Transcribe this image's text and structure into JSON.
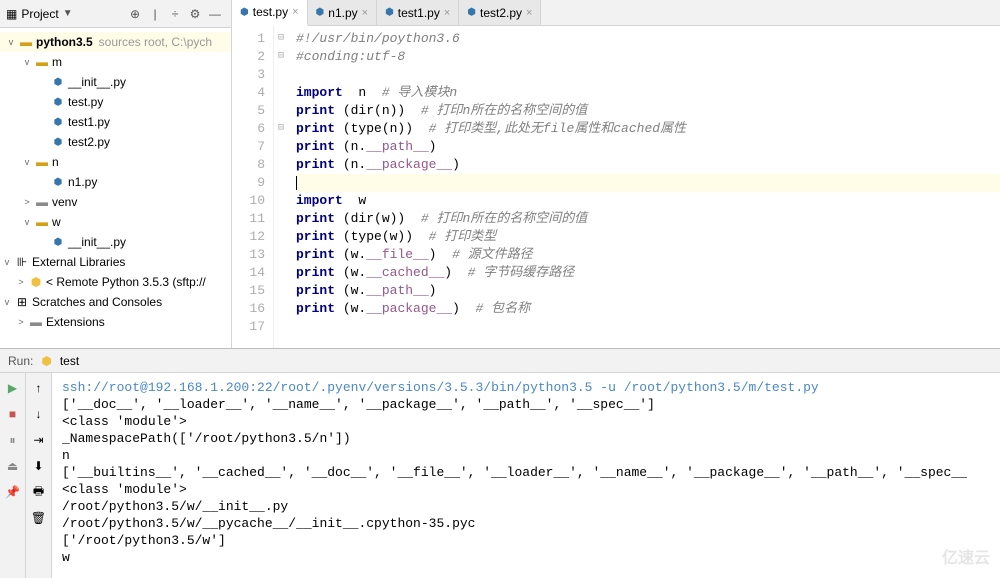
{
  "sidebar": {
    "title": "Project",
    "root": {
      "label": "python3.5",
      "hint": "sources root, C:\\pych"
    },
    "tree": [
      {
        "depth": 1,
        "chev": "v",
        "icon": "folder",
        "iconClass": "folder-yellow",
        "label": "m",
        "bold": false
      },
      {
        "depth": 2,
        "chev": "",
        "icon": "py",
        "label": "__init__.py"
      },
      {
        "depth": 2,
        "chev": "",
        "icon": "py",
        "label": "test.py"
      },
      {
        "depth": 2,
        "chev": "",
        "icon": "py",
        "label": "test1.py"
      },
      {
        "depth": 2,
        "chev": "",
        "icon": "py",
        "label": "test2.py"
      },
      {
        "depth": 1,
        "chev": "v",
        "icon": "folder",
        "iconClass": "folder-yellow",
        "label": "n"
      },
      {
        "depth": 2,
        "chev": "",
        "icon": "py",
        "label": "n1.py"
      },
      {
        "depth": 1,
        "chev": ">",
        "icon": "folder",
        "iconClass": "folder-gray",
        "label": "venv"
      },
      {
        "depth": 1,
        "chev": "v",
        "icon": "folder",
        "iconClass": "folder-yellow",
        "label": "w"
      },
      {
        "depth": 2,
        "chev": "",
        "icon": "py",
        "label": "__init__.py"
      }
    ],
    "ext_lib": "External Libraries",
    "remote": "< Remote Python 3.5.3 (sftp://",
    "scratches": "Scratches and Consoles",
    "extensions": "Extensions"
  },
  "tabs": [
    {
      "label": "test.py",
      "active": true
    },
    {
      "label": "n1.py",
      "active": false
    },
    {
      "label": "test1.py",
      "active": false
    },
    {
      "label": "test2.py",
      "active": false
    }
  ],
  "code": {
    "lines": [
      {
        "n": 1,
        "fold": "⊟",
        "seg": [
          {
            "c": "cm",
            "t": "#!/usr/bin/poython3.6"
          }
        ]
      },
      {
        "n": 2,
        "fold": "⊟",
        "seg": [
          {
            "c": "cm",
            "t": "#conding:utf-8"
          }
        ]
      },
      {
        "n": 3,
        "fold": "",
        "seg": []
      },
      {
        "n": 4,
        "fold": "",
        "seg": [
          {
            "c": "kw",
            "t": "import"
          },
          {
            "c": "",
            "t": "  n  "
          },
          {
            "c": "cm",
            "t": "# 导入模块n"
          }
        ]
      },
      {
        "n": 5,
        "fold": "",
        "seg": [
          {
            "c": "kw",
            "t": "print"
          },
          {
            "c": "",
            "t": " (dir(n))  "
          },
          {
            "c": "cm",
            "t": "# 打印n所在的名称空间的值"
          }
        ]
      },
      {
        "n": 6,
        "fold": "⊟",
        "seg": [
          {
            "c": "kw",
            "t": "print"
          },
          {
            "c": "",
            "t": " (type(n))  "
          },
          {
            "c": "cm",
            "t": "# 打印类型,此处无file属性和cached属性"
          }
        ]
      },
      {
        "n": 7,
        "fold": "",
        "seg": [
          {
            "c": "kw",
            "t": "print"
          },
          {
            "c": "",
            "t": " (n."
          },
          {
            "c": "mag",
            "t": "__path__"
          },
          {
            "c": "",
            "t": ")"
          }
        ]
      },
      {
        "n": 8,
        "fold": "",
        "seg": [
          {
            "c": "kw",
            "t": "print"
          },
          {
            "c": "",
            "t": " (n."
          },
          {
            "c": "mag",
            "t": "__package__"
          },
          {
            "c": "",
            "t": ")"
          }
        ]
      },
      {
        "n": 9,
        "fold": "",
        "hl": true,
        "seg": []
      },
      {
        "n": 10,
        "fold": "",
        "seg": [
          {
            "c": "kw",
            "t": "import"
          },
          {
            "c": "",
            "t": "  w"
          }
        ]
      },
      {
        "n": 11,
        "fold": "",
        "seg": [
          {
            "c": "kw",
            "t": "print"
          },
          {
            "c": "",
            "t": " (dir(w))  "
          },
          {
            "c": "cm",
            "t": "# 打印n所在的名称空间的值"
          }
        ]
      },
      {
        "n": 12,
        "fold": "",
        "seg": [
          {
            "c": "kw",
            "t": "print"
          },
          {
            "c": "",
            "t": " (type(w))  "
          },
          {
            "c": "cm",
            "t": "# 打印类型"
          }
        ]
      },
      {
        "n": 13,
        "fold": "",
        "seg": [
          {
            "c": "kw",
            "t": "print"
          },
          {
            "c": "",
            "t": " (w."
          },
          {
            "c": "mag",
            "t": "__file__"
          },
          {
            "c": "",
            "t": ")  "
          },
          {
            "c": "cm",
            "t": "# 源文件路径"
          }
        ]
      },
      {
        "n": 14,
        "fold": "",
        "seg": [
          {
            "c": "kw",
            "t": "print"
          },
          {
            "c": "",
            "t": " (w."
          },
          {
            "c": "mag",
            "t": "__cached__"
          },
          {
            "c": "",
            "t": ")  "
          },
          {
            "c": "cm",
            "t": "# 字节码缓存路径"
          }
        ]
      },
      {
        "n": 15,
        "fold": "",
        "seg": [
          {
            "c": "kw",
            "t": "print"
          },
          {
            "c": "",
            "t": " (w."
          },
          {
            "c": "mag",
            "t": "__path__"
          },
          {
            "c": "",
            "t": ")"
          }
        ]
      },
      {
        "n": 16,
        "fold": "",
        "seg": [
          {
            "c": "kw",
            "t": "print"
          },
          {
            "c": "",
            "t": " (w."
          },
          {
            "c": "mag",
            "t": "__package__"
          },
          {
            "c": "",
            "t": ")  "
          },
          {
            "c": "cm",
            "t": "# 包名称"
          }
        ]
      },
      {
        "n": 17,
        "fold": "",
        "seg": []
      }
    ]
  },
  "run": {
    "title": "Run:",
    "config": "test",
    "cmd": "ssh://root@192.168.1.200:22/root/.pyenv/versions/3.5.3/bin/python3.5 -u /root/python3.5/m/test.py",
    "out": [
      "['__doc__', '__loader__', '__name__', '__package__', '__path__', '__spec__']",
      "<class 'module'>",
      "_NamespacePath(['/root/python3.5/n'])",
      "n",
      "['__builtins__', '__cached__', '__doc__', '__file__', '__loader__', '__name__', '__package__', '__path__', '__spec__",
      "<class 'module'>",
      "/root/python3.5/w/__init__.py",
      "/root/python3.5/w/__pycache__/__init__.cpython-35.pyc",
      "['/root/python3.5/w']",
      "w"
    ]
  },
  "watermark": "亿速云"
}
